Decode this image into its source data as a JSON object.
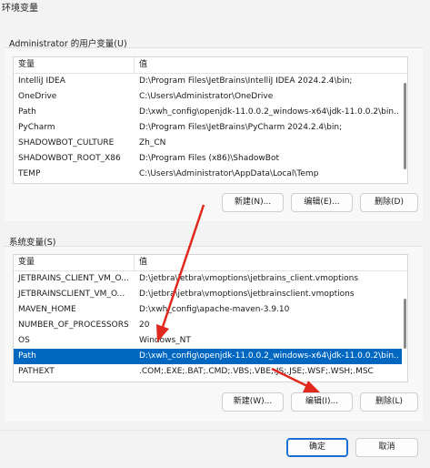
{
  "window": {
    "title": "环境变量"
  },
  "user_section": {
    "label": "Administrator 的用户变量(U)",
    "headers": {
      "name": "变量",
      "value": "值"
    },
    "rows": [
      {
        "name": "IntelliJ IDEA",
        "value": "D:\\Program Files\\JetBrains\\IntelliJ IDEA 2024.2.4\\bin;"
      },
      {
        "name": "OneDrive",
        "value": "C:\\Users\\Administrator\\OneDrive"
      },
      {
        "name": "Path",
        "value": "D:\\xwh_config\\openjdk-11.0.0.2_windows-x64\\jdk-11.0.0.2\\bin..."
      },
      {
        "name": "PyCharm",
        "value": "D:\\Program Files\\JetBrains\\PyCharm 2024.2.4\\bin;"
      },
      {
        "name": "SHADOWBOT_CULTURE",
        "value": "Zh_CN"
      },
      {
        "name": "SHADOWBOT_ROOT_X86",
        "value": "D:\\Program Files (x86)\\ShadowBot"
      },
      {
        "name": "TEMP",
        "value": "C:\\Users\\Administrator\\AppData\\Local\\Temp"
      }
    ],
    "buttons": {
      "new": "新建(N)...",
      "edit": "编辑(E)...",
      "delete": "删除(D)"
    }
  },
  "system_section": {
    "label": "系统变量(S)",
    "headers": {
      "name": "变量",
      "value": "值"
    },
    "rows": [
      {
        "name": "JETBRAINS_CLIENT_VM_O...",
        "value": "D:\\jetbra\\jetbra\\vmoptions\\jetbrains_client.vmoptions"
      },
      {
        "name": "JETBRAINSCLIENT_VM_O...",
        "value": "D:\\jetbra\\jetbra\\vmoptions\\jetbrainsclient.vmoptions"
      },
      {
        "name": "MAVEN_HOME",
        "value": "D:\\xwh_config\\apache-maven-3.9.10"
      },
      {
        "name": "NUMBER_OF_PROCESSORS",
        "value": "20"
      },
      {
        "name": "OS",
        "value": "Windows_NT"
      },
      {
        "name": "Path",
        "value": "D:\\xwh_config\\openjdk-11.0.0.2_windows-x64\\jdk-11.0.0.2\\bin...",
        "selected": true
      },
      {
        "name": "PATHEXT",
        "value": ".COM;.EXE;.BAT;.CMD;.VBS;.VBE;.JS;.JSE;.WSF;.WSH;.MSC"
      }
    ],
    "buttons": {
      "new": "新建(W)...",
      "edit": "编辑(I)...",
      "delete": "删除(L)"
    }
  },
  "footer": {
    "ok": "确定",
    "cancel": "取消"
  },
  "colors": {
    "selection": "#0067c0",
    "annotation_arrow": "#e0281e",
    "primary_border": "#1a6fd1"
  }
}
